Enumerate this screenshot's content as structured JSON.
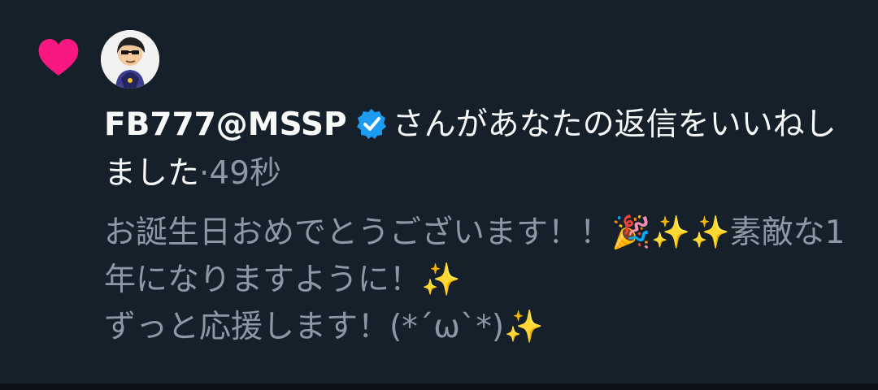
{
  "colors": {
    "background": "#15202b",
    "heart": "#f91880",
    "verified": "#1d9bf0",
    "primary_text": "#f7f9f9",
    "secondary_text": "#8b98a5"
  },
  "notification": {
    "type_icon": "heart-icon",
    "avatar_icon": "avatar",
    "verified_icon": "verified-icon",
    "username": "FB777@MSSP",
    "action": "さんがあなたの返信をいいねしました",
    "separator": "·",
    "time": "49秒",
    "reply_text": "お誕生日おめでとうございます！！🎉✨✨素敵な1年になりますように！✨\nずっと応援します！(*´ω`*)✨"
  }
}
